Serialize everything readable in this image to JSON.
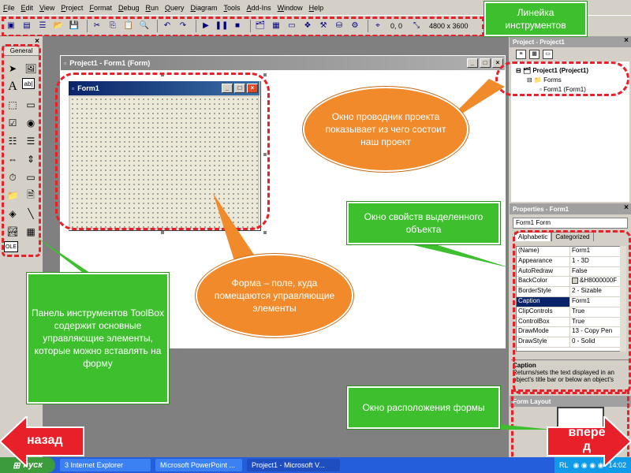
{
  "menubar": {
    "items": [
      "File",
      "Edit",
      "View",
      "Project",
      "Format",
      "Debug",
      "Run",
      "Query",
      "Diagram",
      "Tools",
      "Add-Ins",
      "Window",
      "Help"
    ]
  },
  "toolbar": {
    "position_readout": "0, 0",
    "size_readout": "4800 x 3600"
  },
  "toolbox": {
    "tab_label": "General",
    "close_glyph": "×",
    "tool_label_text": "A",
    "tool_textbox_text": "ab|",
    "tool_data_text": "OLE"
  },
  "project_window": {
    "title": "Project1 - Form1 (Form)"
  },
  "form1": {
    "title": "Form1"
  },
  "project_explorer": {
    "title": "Project - Project1",
    "tree": {
      "root": "Project1 (Project1)",
      "folder": "Forms",
      "item": "Form1 (Form1)"
    }
  },
  "properties": {
    "title": "Properties - Form1",
    "object_selector": "Form1 Form",
    "tabs": [
      "Alphabetic",
      "Categorized"
    ],
    "rows": [
      {
        "name": "(Name)",
        "value": "Form1"
      },
      {
        "name": "Appearance",
        "value": "1 - 3D"
      },
      {
        "name": "AutoRedraw",
        "value": "False"
      },
      {
        "name": "BackColor",
        "value": "&H8000000F"
      },
      {
        "name": "BorderStyle",
        "value": "2 - Sizable"
      },
      {
        "name": "Caption",
        "value": "Form1"
      },
      {
        "name": "ClipControls",
        "value": "True"
      },
      {
        "name": "ControlBox",
        "value": "True"
      },
      {
        "name": "DrawMode",
        "value": "13 - Copy Pen"
      },
      {
        "name": "DrawStyle",
        "value": "0 - Solid"
      }
    ],
    "description_title": "Caption",
    "description_text": "Returns/sets the text displayed in an object's title bar or below an object's"
  },
  "form_layout": {
    "title": "Form Layout"
  },
  "taskbar": {
    "start_label": "пуск",
    "tasks": [
      "3 Internet Explorer",
      "Microsoft PowerPoint ...",
      "Project1 - Microsoft V..."
    ],
    "tray_lang": "RL",
    "tray_time": "14:02"
  },
  "callouts": {
    "toolbar": "Линейка инструментов",
    "explorer": "Окно проводник проекта показывает из чего состоит наш проект",
    "properties": "Окно свойств выделенного объекта",
    "form": "Форма – поле, куда помещаются управляющие элементы",
    "toolbox": "Панель инструментов ToolBox содержит основные управляющие элементы, которые можно вставлять на форму",
    "layout": "Окно расположения формы"
  },
  "nav": {
    "back": "назад",
    "forward": "впере д"
  },
  "colors": {
    "callout_green": "#3ebf2e",
    "bubble_orange": "#f08a2a",
    "frame_red": "#e8202a",
    "nav_red": "#e8202a"
  }
}
